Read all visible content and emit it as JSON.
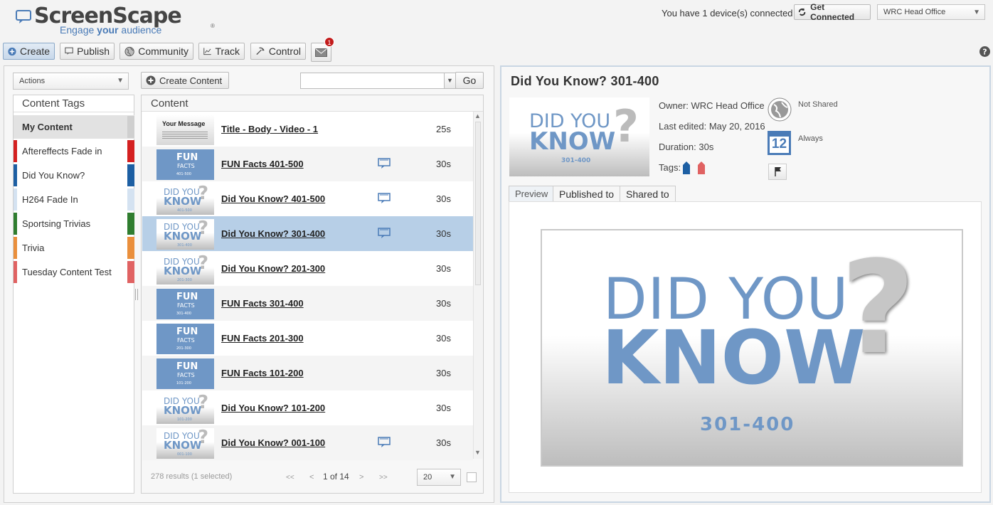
{
  "brand": {
    "name": "ScreenScape",
    "tagline_prefix": "Engage",
    "tagline_bold": "your",
    "tagline_suffix": "audience",
    "registered": "®"
  },
  "header": {
    "devices_text": "You have 1 device(s) connected",
    "get_connected_label": "Get Connected",
    "location_select": "WRC Head Office",
    "help_icon": "question-circle-icon"
  },
  "toolbar": {
    "create": "Create",
    "publish": "Publish",
    "community": "Community",
    "track": "Track",
    "control": "Control",
    "mail_badge": "1"
  },
  "left": {
    "actions_select": "Actions",
    "create_content_label": "Create Content",
    "search_value": "",
    "go_label": "Go",
    "tags_header": "Content Tags",
    "content_header": "Content",
    "tags": [
      {
        "label": "My Content",
        "color": "#cfcfcf"
      },
      {
        "label": "Aftereffects Fade in",
        "color": "#d42020"
      },
      {
        "label": "Did You Know?",
        "color": "#1d5fa3"
      },
      {
        "label": "H264 Fade In",
        "color": "#d4e2f1"
      },
      {
        "label": "Sportsing Trivias",
        "color": "#2f7d2f"
      },
      {
        "label": "Trivia",
        "color": "#ea8f3c"
      },
      {
        "label": "Tuesday Content Test",
        "color": "#e06262"
      }
    ],
    "content": [
      {
        "title": "Title - Body - Video - 1",
        "duration": "25s",
        "thumb": "message",
        "thumb_title": "Your Message",
        "published": false
      },
      {
        "title": "FUN Facts 401-500",
        "duration": "30s",
        "thumb": "fun",
        "range": "401-500",
        "published": true
      },
      {
        "title": "Did You Know? 401-500",
        "duration": "30s",
        "thumb": "dyk",
        "range": "401-500",
        "published": true
      },
      {
        "title": "Did You Know? 301-400",
        "duration": "30s",
        "thumb": "dyk",
        "range": "301-400",
        "published": true
      },
      {
        "title": "Did You Know? 201-300",
        "duration": "30s",
        "thumb": "dyk",
        "range": "201-300",
        "published": false
      },
      {
        "title": "FUN Facts 301-400",
        "duration": "30s",
        "thumb": "fun",
        "range": "301-400",
        "published": false
      },
      {
        "title": "FUN Facts 201-300",
        "duration": "30s",
        "thumb": "fun",
        "range": "201-300",
        "published": false
      },
      {
        "title": "FUN Facts 101-200",
        "duration": "30s",
        "thumb": "fun",
        "range": "101-200",
        "published": false
      },
      {
        "title": "Did You Know? 101-200",
        "duration": "30s",
        "thumb": "dyk",
        "range": "101-200",
        "published": false
      },
      {
        "title": "Did You Know? 001-100",
        "duration": "30s",
        "thumb": "dyk",
        "range": "001-100",
        "published": true
      }
    ],
    "selected_index": 3,
    "results_text": "278 results (1 selected)",
    "first": "<<",
    "prev": "<",
    "page_text": "1 of 14",
    "next": ">",
    "last": ">>",
    "per_page": "20"
  },
  "detail": {
    "title": "Did You Know? 301-400",
    "owner": "Owner: WRC Head Office",
    "last_edited": "Last edited: May 20, 2016",
    "duration": "Duration: 30s",
    "tags_label": "Tags:",
    "sharing": "Not Shared",
    "calendar_day": "12",
    "schedule": "Always",
    "tabs": [
      "Preview",
      "Published to",
      "Shared to"
    ],
    "preview_line1": "DID YOU",
    "preview_line2": "KNOW",
    "preview_range": "301-400",
    "preview_q": "?"
  },
  "thumb_text": {
    "did_you": "DID YOU",
    "know": "KNOW",
    "q": "?",
    "fun": "FUN",
    "facts": "FACTS"
  },
  "colors": {
    "accent": "#4a7bb7",
    "selected_row": "#b7cfe7",
    "knowblue": "#6f97c6"
  }
}
